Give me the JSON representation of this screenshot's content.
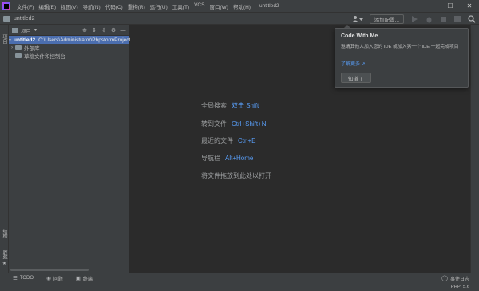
{
  "menu": {
    "items": [
      "文件(F)",
      "编辑(E)",
      "视图(V)",
      "导航(N)",
      "代码(C)",
      "重构(R)",
      "运行(U)",
      "工具(T)",
      "VCS",
      "窗口(W)",
      "帮助(H)"
    ]
  },
  "window": {
    "title": "untitled2",
    "controls": {
      "minimize": "─",
      "maximize": "☐",
      "close": "✕"
    }
  },
  "navbar": {
    "project_name": "untitled2",
    "add_config_label": "添加配置...",
    "icons": [
      "user-icon",
      "run-icon",
      "debug-icon",
      "coverage-icon",
      "stop-icon",
      "search-icon"
    ]
  },
  "left_strip": {
    "project_tab": "项目",
    "structure_tab": "结构",
    "favorites_tab": "收藏"
  },
  "project_panel": {
    "title": "项目",
    "tree": [
      {
        "name": "untitled2",
        "path": "C:\\Users\\Administrator\\PhpstormProjects\\untitled2",
        "selected": true
      },
      {
        "name": "外部库"
      },
      {
        "name": "草稿文件和控制台"
      }
    ]
  },
  "editor": {
    "hints": [
      {
        "label": "全局搜索",
        "shortcut": "双击 Shift"
      },
      {
        "label": "转到文件",
        "shortcut": "Ctrl+Shift+N"
      },
      {
        "label": "最近的文件",
        "shortcut": "Ctrl+E"
      },
      {
        "label": "导航栏",
        "shortcut": "Alt+Home"
      },
      {
        "label": "将文件拖放到此处以打开",
        "shortcut": ""
      }
    ]
  },
  "popup": {
    "title": "Code With Me",
    "description": "邀请其他人加入您的 IDE 或加入另一个 IDE 一起完成项目",
    "link": "了解更多 ↗",
    "button": "知道了"
  },
  "statusbar": {
    "tabs": [
      "TODO",
      "问题",
      "终端"
    ],
    "event_log": "事件日志",
    "php_version": "PHP: 5.6"
  },
  "colors": {
    "accent": "#4b6eaf",
    "link": "#589df6",
    "panel_bg": "#3c3f41",
    "editor_bg": "#2b2b2b"
  }
}
